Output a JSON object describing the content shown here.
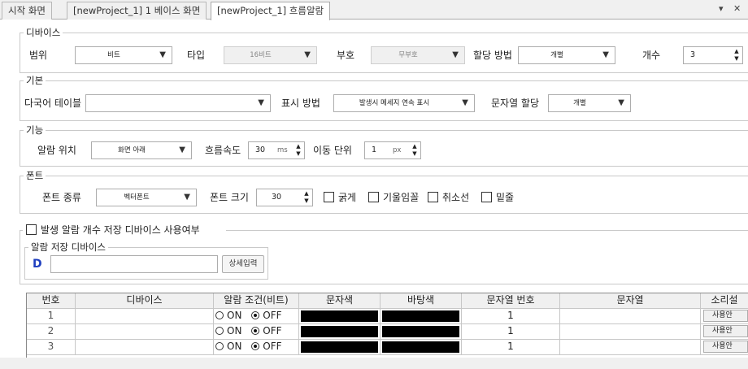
{
  "tabs": [
    {
      "label": "시작 화면"
    },
    {
      "label": "[newProject_1] 1 베이스 화면"
    },
    {
      "label": "[newProject_1] 흐름알람"
    }
  ],
  "window_controls": {
    "menu_glyph": "▾",
    "close_glyph": "✕"
  },
  "device": {
    "title": "디바이스",
    "range_label": "범위",
    "range_value": "비트",
    "type_label": "타입",
    "type_value": "16비트",
    "sign_label": "부호",
    "sign_value": "무부호",
    "alloc_label": "할당 방법",
    "alloc_value": "개별",
    "count_label": "개수",
    "count_value": "3"
  },
  "basic": {
    "title": "기본",
    "multilang_label": "다국어 테이블",
    "multilang_value": "",
    "display_label": "표시 방법",
    "display_value": "발생시 메세지 연속 표시",
    "stralloc_label": "문자열 할당",
    "stralloc_value": "개별"
  },
  "function": {
    "title": "기능",
    "position_label": "알람 위치",
    "position_value": "화면 아래",
    "speed_label": "흐름속도",
    "speed_value": "30",
    "speed_unit": "ms",
    "step_label": "이동 단위",
    "step_value": "1",
    "step_unit": "px"
  },
  "font": {
    "title": "폰트",
    "kind_label": "폰트 종류",
    "kind_value": "벡터폰트",
    "size_label": "폰트 크기",
    "size_value": "30",
    "bold_label": "굵게",
    "italic_label": "기울임꼴",
    "strike_label": "취소선",
    "underline_label": "밑줄"
  },
  "storage": {
    "use_label": "발생 알람 개수 저장 디바이스 사용여부",
    "device_title": "알람 저장 디바이스",
    "device_prefix": "D",
    "device_value": "",
    "detail_button": "상세입력"
  },
  "table": {
    "headers": [
      "번호",
      "디바이스",
      "알람 조건(비트)",
      "문자색",
      "바탕색",
      "문자열 번호",
      "문자열",
      "소리설"
    ],
    "on_label": "ON",
    "off_label": "OFF",
    "rows": [
      {
        "no": "1",
        "device": "",
        "string_no": "1",
        "string": "",
        "sound": "사용안"
      },
      {
        "no": "2",
        "device": "",
        "string_no": "1",
        "string": "",
        "sound": "사용안"
      },
      {
        "no": "3",
        "device": "",
        "string_no": "1",
        "string": "",
        "sound": "사용안"
      }
    ]
  },
  "colors": {
    "text_color_cell": "#000000",
    "bg_color_cell": "#000000",
    "accent": "#1f3fbf"
  }
}
